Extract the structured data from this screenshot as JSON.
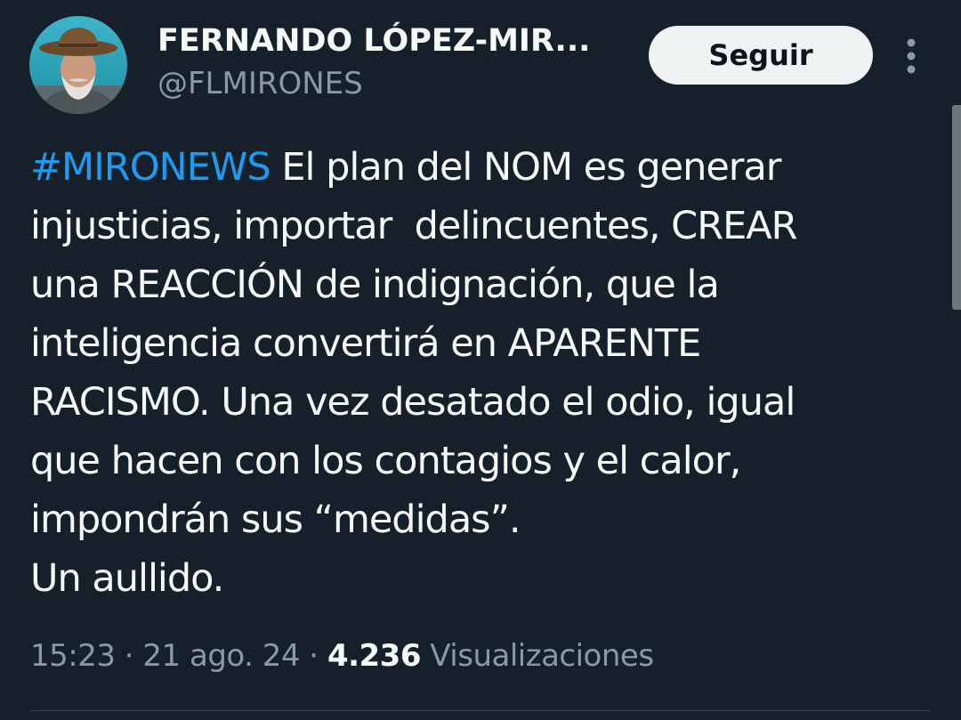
{
  "author": {
    "display_name": "FERNANDO LÓPEZ-MIR...",
    "handle": "@FLMIRONES",
    "avatar_icon": "avatar-photo"
  },
  "follow_button": {
    "label": "Seguir"
  },
  "more_icon": "vertical-ellipsis-icon",
  "tweet": {
    "hashtag": "#MIRONEWS",
    "lines": [
      " El plan del NOM es generar",
      "injusticias, importar  delincuentes, CREAR",
      "una REACCIÓN de indignación, que la",
      "inteligencia convertirá en APARENTE",
      "RACISMO. Una vez desatado el odio, igual",
      "que hacen con los contagios y el calor,",
      "impondrán sus “medidas”.",
      "Un aullido."
    ]
  },
  "meta": {
    "time": "15:23",
    "separator": " · ",
    "date": "21 ago. 24",
    "views_count": "4.236",
    "views_label": " Visualizaciones"
  },
  "colors": {
    "background": "#15202b",
    "text": "#f7f9f9",
    "secondary": "#8b98a5",
    "link": "#1d9bf0",
    "button_bg": "#eff3f4"
  }
}
